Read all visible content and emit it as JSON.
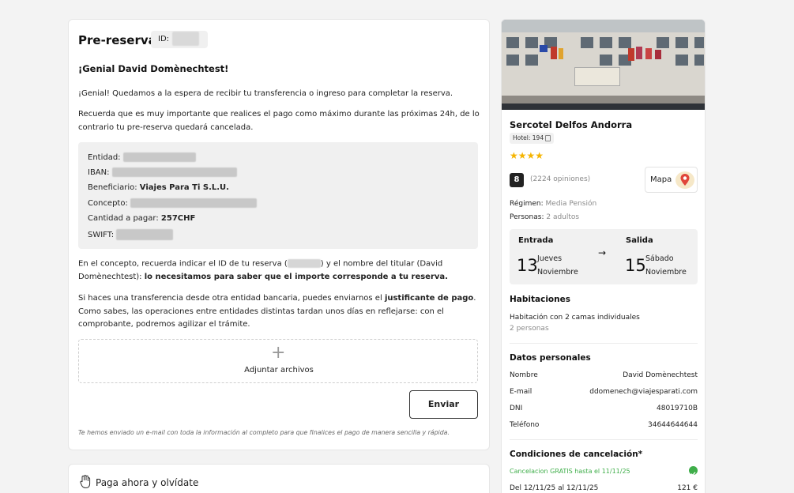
{
  "prereserva": {
    "title": "Pre-reserva",
    "id_label": "ID:",
    "greeting": "¡Genial David Domènechtest!",
    "para1": "¡Genial! Quedamos a la espera de recibir tu transferencia o ingreso para completar la reserva.",
    "para2_line1": "Recuerda que es muy importante que realices el pago como máximo durante las próximas 24h, de lo",
    "para2_line2": "contrario tu pre-reserva quedará cancelada.",
    "bank": {
      "entidad_label": "Entidad:",
      "iban_label": "IBAN:",
      "beneficiario_label": "Beneficiario:",
      "beneficiario_value": "Viajes Para Ti S.L.U.",
      "concepto_label": "Concepto:",
      "cantidad_label": "Cantidad a pagar:",
      "cantidad_value": "257CHF",
      "swift_label": "SWIFT:"
    },
    "concept_line1_a": "En el concepto, recuerda indicar el ID de tu reserva (",
    "concept_line1_b": ") y el nombre del titular (David",
    "concept_line2_a": "Domènechtest):",
    "concept_line2_b": "lo necesitamos para saber que el importe corresponde a tu reserva.",
    "transfer_line1_a": "Si haces una transferencia desde otra entidad bancaria, puedes enviarnos el",
    "transfer_line1_b": "justificante de pago",
    "transfer_line1_c": ".",
    "transfer_line2": "Como sabes, las operaciones entre entidades distintas tardan unos días en reflejarse: con el",
    "transfer_line3": "comprobante, podremos agilizar el trámite.",
    "attach_label": "Adjuntar archivos",
    "send_label": "Enviar",
    "footnote": "Te hemos enviado un e-mail con toda la información al completo para que finalices el pago de manera sencilla y rápida."
  },
  "pay_now": {
    "title": "Paga ahora y olvídate"
  },
  "hotel": {
    "name": "Sercotel Delfos Andorra",
    "hotel_tag": "Hotel: 194",
    "stars": 4,
    "rating": "8",
    "reviews": "(2224 opiniones)",
    "map_label": "Mapa",
    "regimen_label": "Régimen:",
    "regimen_value": "Media Pensión",
    "personas_label": "Personas:",
    "personas_value": "2 adultos"
  },
  "dates": {
    "checkin_label": "Entrada",
    "checkout_label": "Salida",
    "checkin_day": "13",
    "checkin_weekday": "Jueves",
    "checkin_month": "Noviembre",
    "checkout_day": "15",
    "checkout_weekday": "Sábado",
    "checkout_month": "Noviembre",
    "arrow": "→"
  },
  "rooms": {
    "title": "Habitaciones",
    "room_desc": "Habitación con 2 camas individuales",
    "room_people": "2 personas"
  },
  "personal": {
    "title": "Datos personales",
    "rows": [
      {
        "label": "Nombre",
        "value": "David Domènechtest"
      },
      {
        "label": "E-mail",
        "value": "ddomenech@viajesparati.com"
      },
      {
        "label": "DNI",
        "value": "48019710B"
      },
      {
        "label": "Teléfono",
        "value": "34644644644"
      }
    ]
  },
  "cancel": {
    "title": "Condiciones de cancelación*",
    "free_text": "Cancelacion GRATIS hasta el 11/11/25",
    "range_text": "Del 12/11/25 al 12/11/25",
    "range_price": "121 €"
  },
  "colors": {
    "star": "#f5b400",
    "free_green": "#3fae4a",
    "map_pin": "#e0453a"
  }
}
